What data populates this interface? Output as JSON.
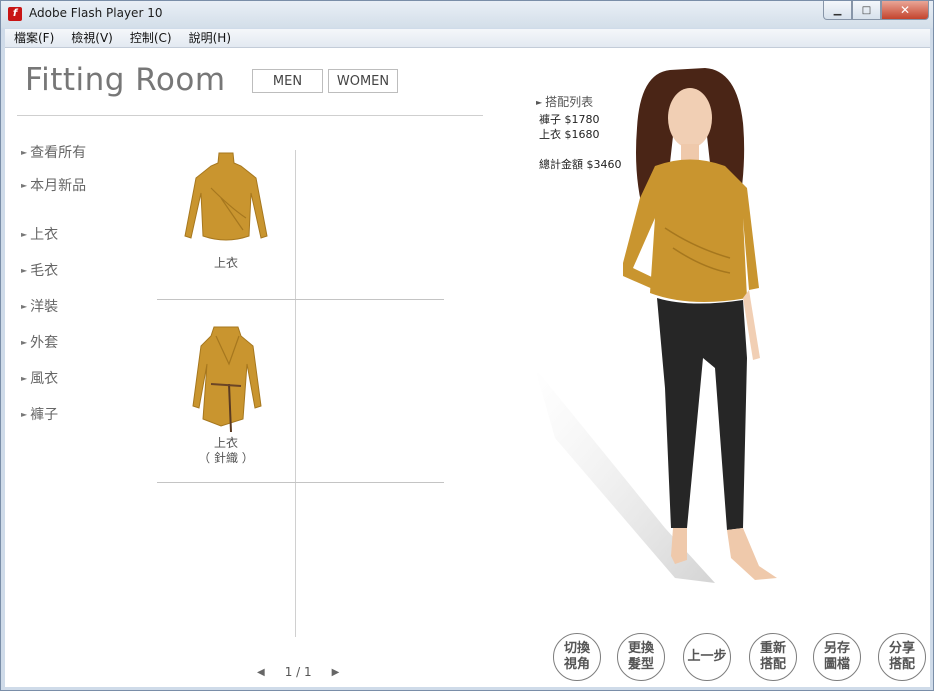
{
  "window": {
    "title": "Adobe Flash Player 10"
  },
  "menubar": [
    "檔案(F)",
    "檢視(V)",
    "控制(C)",
    "說明(H)"
  ],
  "header": {
    "brand": "Fitting Room",
    "men": "MEN",
    "women": "WOMEN"
  },
  "categories": [
    "查看所有",
    "本月新品",
    "上衣",
    "毛衣",
    "洋裝",
    "外套",
    "風衣",
    "褲子"
  ],
  "items": [
    {
      "label": "上衣"
    },
    {
      "label": "上衣\n（ 針織 ）"
    }
  ],
  "pager": {
    "text": "1 / 1"
  },
  "combo": {
    "title": "搭配列表",
    "lines": [
      "褲子 $1780",
      "上衣 $1680"
    ],
    "total": "總計金額 $3460"
  },
  "actions": [
    "切換\n視角",
    "更換\n髮型",
    "上一步",
    "重新\n搭配",
    "另存\n圖檔",
    "分享\n搭配"
  ],
  "colors": {
    "garment": "#c9952f",
    "pants": "#262626",
    "hair": "#4a2516"
  }
}
